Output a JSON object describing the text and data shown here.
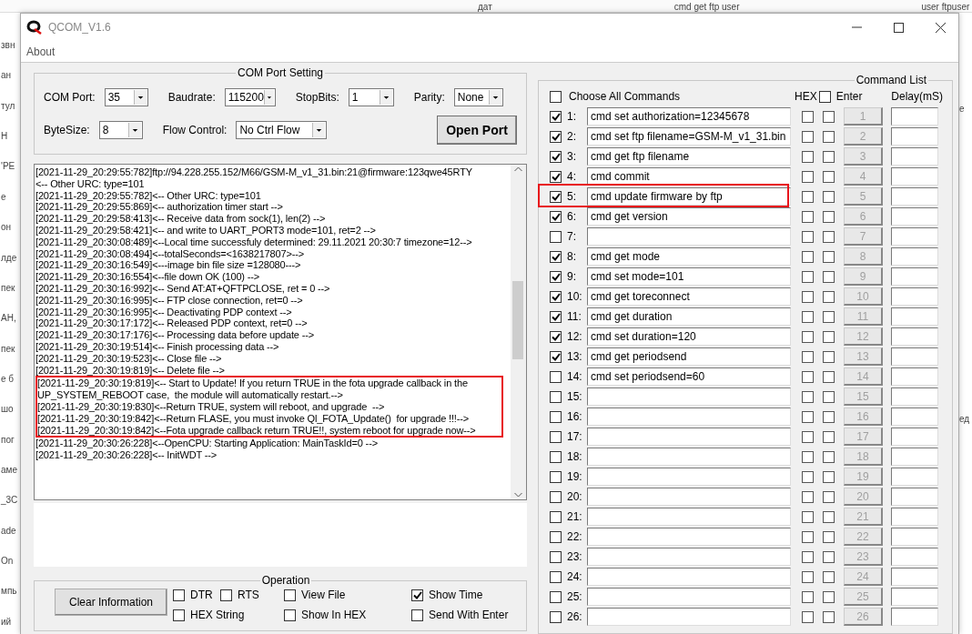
{
  "background": {
    "top_texts": [
      "дат",
      "cmd get ftp user",
      "user ftpuser"
    ],
    "left_texts": [
      "звн",
      "ан",
      "тул",
      "Н",
      "'РЕ",
      "е",
      "он",
      "лде",
      "пек",
      "АН,",
      "пек",
      "е б",
      "шо",
      "пог",
      "аме",
      "_3C",
      "ade",
      "On",
      "мпь",
      "ий"
    ],
    "right_texts": [
      "е",
      "ед"
    ]
  },
  "window": {
    "title": "QCOM_V1.6"
  },
  "menu": [
    "About"
  ],
  "com_port_setting": {
    "title": "COM Port Setting",
    "rows": [
      [
        {
          "label": "COM Port:",
          "value": "35"
        },
        {
          "label": "Baudrate:",
          "value": "115200"
        },
        {
          "label": "StopBits:",
          "value": "1"
        },
        {
          "label": "Parity:",
          "value": "None"
        }
      ],
      [
        {
          "label": "ByteSize:",
          "value": "8"
        },
        {
          "label": "Flow Control:",
          "value": "No Ctrl Flow"
        }
      ]
    ],
    "open_button": "Open Port"
  },
  "log": [
    {
      "text": "[2021-11-29_20:29:55:782]ftp://94.228.255.152/M66/GSM-M_v1_31.bin:21@firmware:123qwe45RTY",
      "highlighted": false
    },
    {
      "text": "<-- Other URC: type=101",
      "highlighted": false
    },
    {
      "text": "[2021-11-29_20:29:55:782]<-- Other URC: type=101",
      "highlighted": false
    },
    {
      "text": "[2021-11-29_20:29:55:869]<-- authorization timer start -->",
      "highlighted": false
    },
    {
      "text": "[2021-11-29_20:29:58:413]<-- Receive data from sock(1), len(2) -->",
      "highlighted": false
    },
    {
      "text": "[2021-11-29_20:29:58:421]<-- and write to UART_PORT3 mode=101, ret=2 -->",
      "highlighted": false
    },
    {
      "text": "[2021-11-29_20:30:08:489]<--Local time successfuly determined: 29.11.2021 20:30:7 timezone=12-->",
      "highlighted": false
    },
    {
      "text": "[2021-11-29_20:30:08:494]<--totalSeconds=<1638217807>-->",
      "highlighted": false
    },
    {
      "text": "[2021-11-29_20:30:16:549]<---image bin file size =128080--->",
      "highlighted": false
    },
    {
      "text": "[2021-11-29_20:30:16:554]<--file down OK (100) -->",
      "highlighted": false
    },
    {
      "text": "[2021-11-29_20:30:16:992]<-- Send AT:AT+QFTPCLOSE, ret = 0 -->",
      "highlighted": false
    },
    {
      "text": "[2021-11-29_20:30:16:995]<-- FTP close connection, ret=0 -->",
      "highlighted": false
    },
    {
      "text": "[2021-11-29_20:30:16:995]<-- Deactivating PDP context -->",
      "highlighted": false
    },
    {
      "text": "[2021-11-29_20:30:17:172]<-- Released PDP context, ret=0 -->",
      "highlighted": false
    },
    {
      "text": "[2021-11-29_20:30:17:176]<-- Processing data before update -->",
      "highlighted": false
    },
    {
      "text": "[2021-11-29_20:30:19:514]<-- Finish processing data -->",
      "highlighted": false
    },
    {
      "text": "[2021-11-29_20:30:19:523]<-- Close file -->",
      "highlighted": false
    },
    {
      "text": "[2021-11-29_20:30:19:819]<-- Delete file -->",
      "highlighted": false
    },
    {
      "text": "[2021-11-29_20:30:19:819]<-- Start to Update! If you return TRUE in the fota upgrade callback in the UP_SYSTEM_REBOOT case,  the module will automatically restart.-->",
      "highlighted": true
    },
    {
      "text": "[2021-11-29_20:30:19:830]<--Return TRUE, system will reboot, and upgrade  -->",
      "highlighted": true
    },
    {
      "text": "[2021-11-29_20:30:19:842]<--Return FLASE, you must invoke Ql_FOTA_Update()  for upgrade !!!-->",
      "highlighted": true
    },
    {
      "text": "[2021-11-29_20:30:19:842]<--Fota upgrade callback return TRUE!!, system reboot for upgrade now-->",
      "highlighted": true
    },
    {
      "text": "[2021-11-29_20:30:26:228]<--OpenCPU: Starting Application: MainTaskId=0 -->",
      "highlighted": false
    },
    {
      "text": "[2021-11-29_20:30:26:228]<-- InitWDT -->",
      "highlighted": false
    }
  ],
  "operation": {
    "title": "Operation",
    "clear_button": "Clear Information",
    "options": [
      {
        "label": "DTR",
        "checked": false
      },
      {
        "label": "RTS",
        "checked": false
      },
      {
        "label": "View File",
        "checked": false
      },
      {
        "label": "Show Time",
        "checked": true
      },
      {
        "label": "HEX String",
        "checked": false
      },
      {
        "label": "Show In HEX",
        "checked": false
      },
      {
        "label": "Send With Enter",
        "checked": false
      }
    ]
  },
  "command_list": {
    "title": "Command List",
    "choose_all": {
      "label": "Choose All Commands",
      "checked": false
    },
    "hex_header": "HEX",
    "enter_header": {
      "label": "Enter",
      "checked": false
    },
    "delay_header": "Delay(mS)",
    "commands": [
      {
        "label": "1:",
        "checked": true,
        "text": "cmd set authorization=12345678",
        "hex": false,
        "enter": false,
        "button": "1",
        "highlighted": false
      },
      {
        "label": "2:",
        "checked": true,
        "text": "cmd set ftp filename=GSM-M_v1_31.bin",
        "hex": false,
        "enter": false,
        "button": "2",
        "highlighted": false
      },
      {
        "label": "3:",
        "checked": true,
        "text": "cmd get ftp filename",
        "hex": false,
        "enter": false,
        "button": "3",
        "highlighted": false
      },
      {
        "label": "4:",
        "checked": true,
        "text": "cmd commit",
        "hex": false,
        "enter": false,
        "button": "4",
        "highlighted": false
      },
      {
        "label": "5:",
        "checked": true,
        "text": "cmd update firmware by ftp",
        "hex": false,
        "enter": false,
        "button": "5",
        "highlighted": true
      },
      {
        "label": "6:",
        "checked": true,
        "text": "cmd get version",
        "hex": false,
        "enter": false,
        "button": "6",
        "highlighted": false
      },
      {
        "label": "7:",
        "checked": false,
        "hex": false,
        "enter": false,
        "button": "7",
        "highlighted": false
      },
      {
        "label": "8:",
        "checked": true,
        "text": "cmd get mode",
        "hex": false,
        "enter": false,
        "button": "8",
        "highlighted": false
      },
      {
        "label": "9:",
        "checked": true,
        "text": "cmd set mode=101",
        "hex": false,
        "enter": false,
        "button": "9",
        "highlighted": false
      },
      {
        "label": "10:",
        "checked": true,
        "text": "cmd get toreconnect",
        "hex": false,
        "enter": false,
        "button": "10",
        "highlighted": false
      },
      {
        "label": "11:",
        "checked": true,
        "text": "cmd get duration",
        "hex": false,
        "enter": false,
        "button": "11",
        "highlighted": false
      },
      {
        "label": "12:",
        "checked": true,
        "text": "cmd set duration=120",
        "hex": false,
        "enter": false,
        "button": "12",
        "highlighted": false
      },
      {
        "label": "13:",
        "checked": true,
        "text": "cmd get periodsend",
        "hex": false,
        "enter": false,
        "button": "13",
        "highlighted": false
      },
      {
        "label": "14:",
        "checked": false,
        "text": "cmd set periodsend=60",
        "hex": false,
        "enter": false,
        "button": "14",
        "highlighted": false
      },
      {
        "label": "15:",
        "checked": false,
        "hex": false,
        "enter": false,
        "button": "15",
        "highlighted": false
      },
      {
        "label": "16:",
        "checked": false,
        "hex": false,
        "enter": false,
        "button": "16",
        "highlighted": false
      },
      {
        "label": "17:",
        "checked": false,
        "hex": false,
        "enter": false,
        "button": "17",
        "highlighted": false
      },
      {
        "label": "18:",
        "checked": false,
        "hex": false,
        "enter": false,
        "button": "18",
        "highlighted": false
      },
      {
        "label": "19:",
        "checked": false,
        "hex": false,
        "enter": false,
        "button": "19",
        "highlighted": false
      },
      {
        "label": "20:",
        "checked": false,
        "hex": false,
        "enter": false,
        "button": "20",
        "highlighted": false
      },
      {
        "label": "21:",
        "checked": false,
        "hex": false,
        "enter": false,
        "button": "21",
        "highlighted": false
      },
      {
        "label": "22:",
        "checked": false,
        "hex": false,
        "enter": false,
        "button": "22",
        "highlighted": false
      },
      {
        "label": "23:",
        "checked": false,
        "hex": false,
        "enter": false,
        "button": "23",
        "highlighted": false
      },
      {
        "label": "24:",
        "checked": false,
        "hex": false,
        "enter": false,
        "button": "24",
        "highlighted": false
      },
      {
        "label": "25:",
        "checked": false,
        "hex": false,
        "enter": false,
        "button": "25",
        "highlighted": false
      },
      {
        "label": "26:",
        "checked": false,
        "hex": false,
        "enter": false,
        "button": "26",
        "highlighted": false
      }
    ]
  }
}
